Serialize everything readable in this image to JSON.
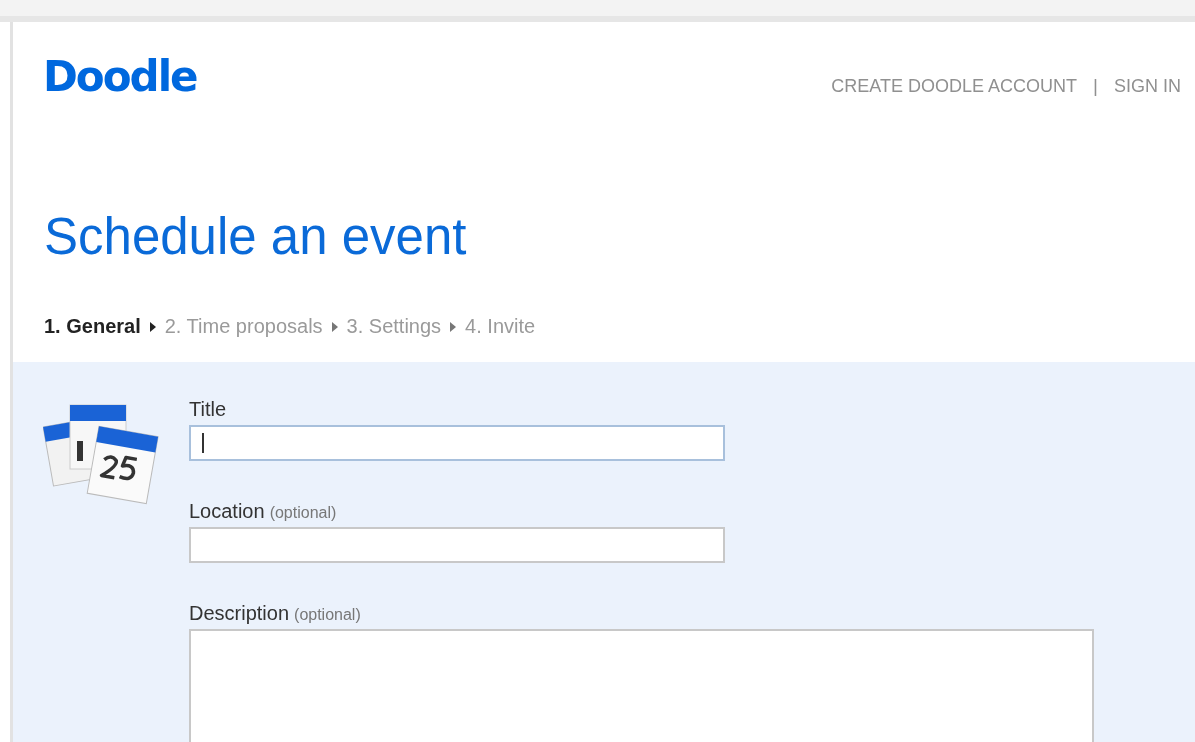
{
  "logo": "Doodle",
  "nav": [
    {
      "label": "CREATE DOODLE ACCOUNT"
    },
    {
      "label": "SIGN IN"
    }
  ],
  "nav_separator": "|",
  "heading": "Schedule an event",
  "steps": [
    {
      "label": "1. General",
      "selected": true
    },
    {
      "label": "2. Time proposals",
      "selected": false
    },
    {
      "label": "3. Settings",
      "selected": false
    },
    {
      "label": "4. Invite",
      "selected": false
    }
  ],
  "fields": [
    {
      "kind": "input",
      "label": "Title",
      "focused": true
    },
    {
      "kind": "input",
      "label": "Location",
      "note": "(optional)",
      "focused": false
    },
    {
      "kind": "textarea",
      "label": "Description",
      "note": "(optional)",
      "focused": false
    }
  ]
}
